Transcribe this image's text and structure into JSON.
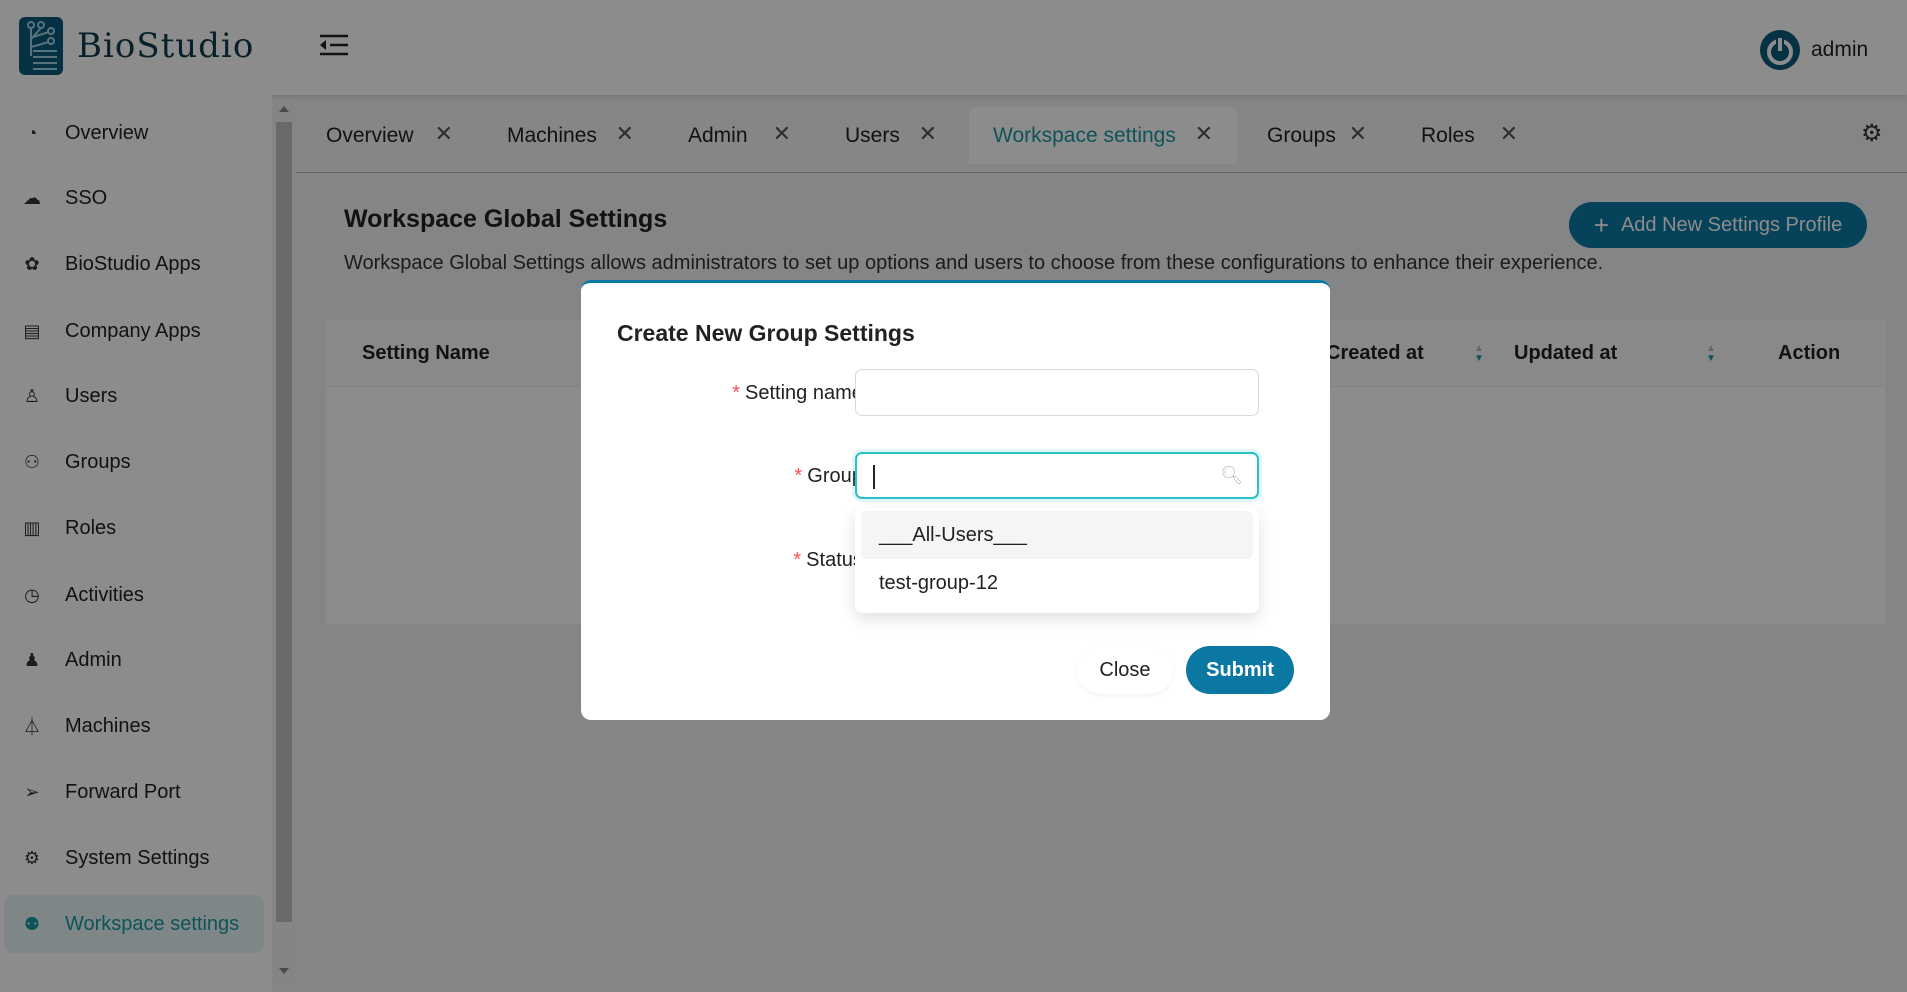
{
  "header": {
    "brand": "BioStudio",
    "user": "admin"
  },
  "sidebar": {
    "items": [
      {
        "label": "Overview",
        "icon": "dashboard-icon"
      },
      {
        "label": "SSO",
        "icon": "sso-icon"
      },
      {
        "label": "BioStudio Apps",
        "icon": "apps-icon"
      },
      {
        "label": "Company Apps",
        "icon": "company-apps-icon"
      },
      {
        "label": "Users",
        "icon": "user-icon"
      },
      {
        "label": "Groups",
        "icon": "group-icon"
      },
      {
        "label": "Roles",
        "icon": "roles-icon"
      },
      {
        "label": "Activities",
        "icon": "activity-icon"
      },
      {
        "label": "Admin",
        "icon": "admin-icon"
      },
      {
        "label": "Machines",
        "icon": "machine-icon"
      },
      {
        "label": "Forward Port",
        "icon": "send-icon"
      },
      {
        "label": "System Settings",
        "icon": "gear-icon"
      },
      {
        "label": "Workspace settings",
        "icon": "user-settings-icon",
        "active": true
      }
    ]
  },
  "tabs": [
    {
      "label": "Overview"
    },
    {
      "label": "Machines"
    },
    {
      "label": "Admin"
    },
    {
      "label": "Users"
    },
    {
      "label": "Workspace settings",
      "active": true
    },
    {
      "label": "Groups"
    },
    {
      "label": "Roles"
    }
  ],
  "page": {
    "title": "Workspace Global Settings",
    "description": "Workspace Global Settings allows administrators to set up options and users to choose from these configurations to enhance their experience.",
    "add_button": "Add New Settings Profile",
    "table": {
      "columns": [
        "Setting Name",
        "Created at",
        "Updated at",
        "Action"
      ]
    }
  },
  "modal": {
    "title": "Create New Group Settings",
    "fields": {
      "setting_name": {
        "label": "Setting name",
        "value": ""
      },
      "group": {
        "label": "Group",
        "value": ""
      },
      "status": {
        "label": "Status"
      }
    },
    "group_options": [
      "___All-Users___",
      "test-group-12"
    ],
    "close": "Close",
    "submit": "Submit"
  },
  "colors": {
    "accent": "#0b78a3",
    "active": "#1b9aa0",
    "required": "#ff4d4f"
  }
}
